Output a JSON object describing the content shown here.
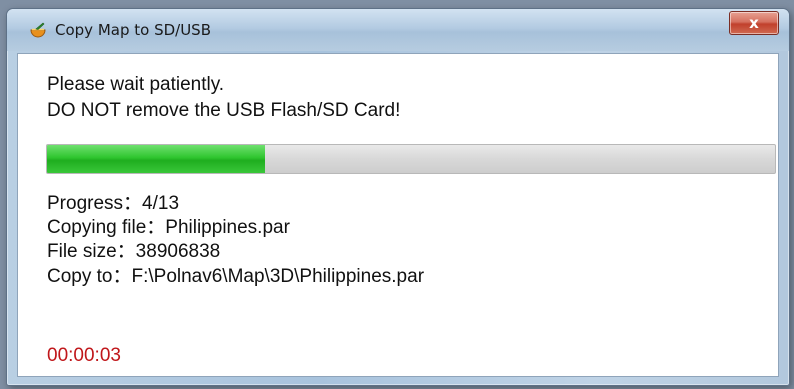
{
  "window": {
    "title": "Copy Map to SD/USB",
    "close_label": "x"
  },
  "message": {
    "line1": "Please wait patiently.",
    "line2": "DO NOT remove the USB Flash/SD Card!"
  },
  "progress": {
    "fraction": 0.3,
    "fill_color": "#2fc52f"
  },
  "info": {
    "progress": "Progress：4/13",
    "copying_file": "Copying file：Philippines.par",
    "file_size": "File size：38906838",
    "copy_to": "Copy to：F:\\Polnav6\\Map\\3D\\Philippines.par"
  },
  "elapsed_time": "00:00:03",
  "colors": {
    "timer": "#c0161a",
    "close_button": "#c1402c"
  },
  "icons": {
    "app_icon": "app-map-icon"
  }
}
